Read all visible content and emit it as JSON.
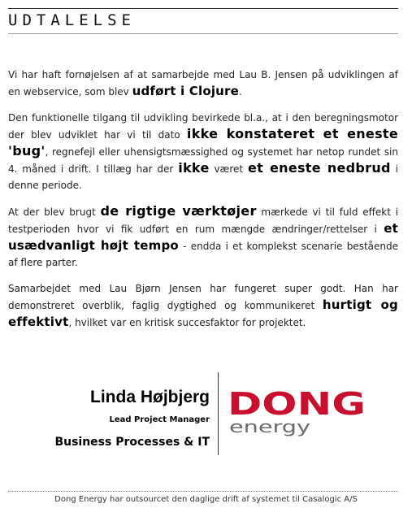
{
  "header": {
    "title": "UDTALELSE"
  },
  "paragraphs": {
    "p1": {
      "a": "Vi har haft fornøjelsen af at samarbejde med Lau B. Jensen på udviklingen af en webservice, som blev ",
      "b": "udført i Clojure",
      "c": "."
    },
    "p2": {
      "a": "Den funktionelle tilgang til udvikling bevirkede bl.a., at i den beregningsmotor der blev udviklet har vi til dato ",
      "b": "ikke konstateret et eneste 'bug'",
      "c": ", regnefejl eller uhensigtsmæssighed og systemet har netop rundet sin 4. måned i drift. I tillæg har der ",
      "d": "ikke",
      "e": " været ",
      "f": "et eneste nedbrud",
      "g": " i denne periode."
    },
    "p3": {
      "a": "At der blev brugt ",
      "b": "de rigtige værktøjer",
      "c": " mærkede vi til fuld effekt i testperioden hvor vi fik udført en rum mængde ændringer/rettelser i ",
      "d": "et usædvanligt højt tempo",
      "e": " - endda i et komplekst scenarie bestående af flere parter."
    },
    "p4": {
      "a": "Samarbejdet med Lau Bjørn Jensen har fungeret super godt. Han har demonstreret overblik, faglig dygtighed og kommunikeret ",
      "b": "hurtigt og effektivt",
      "c": ", hvilket var en kritisk succesfaktor for projektet."
    }
  },
  "signature": {
    "name": "Linda Højbjerg",
    "role": "Lead Project Manager",
    "department": "Business Processes & IT"
  },
  "logo": {
    "text_main": "DONG",
    "text_sub": "energy",
    "color": "#c8102e"
  },
  "footer": {
    "text": "Dong Energy har outsourcet den daglige drift af systemet til Casalogic A/S"
  }
}
